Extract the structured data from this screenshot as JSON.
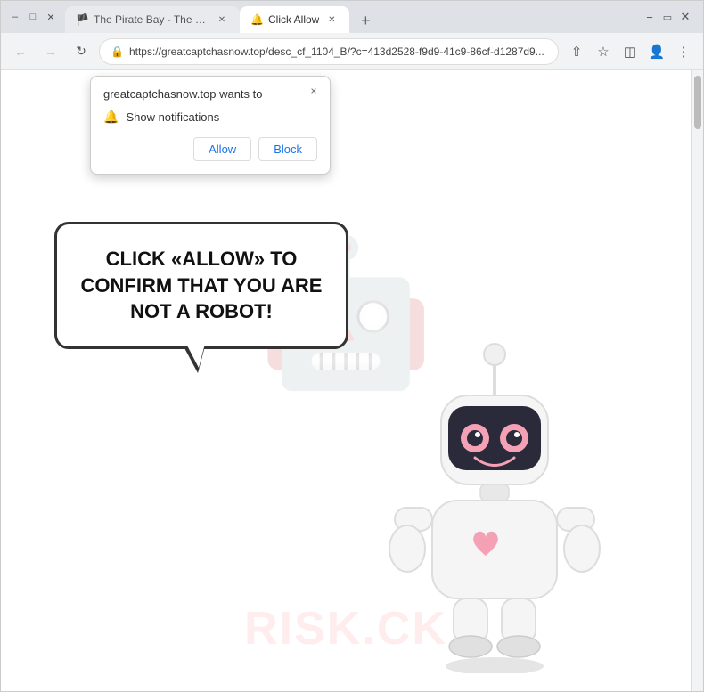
{
  "browser": {
    "tabs": [
      {
        "id": "tab1",
        "title": "The Pirate Bay - The galaxy's mo...",
        "favicon": "🏴",
        "active": false
      },
      {
        "id": "tab2",
        "title": "Click Allow",
        "favicon": "🔔",
        "active": true
      }
    ],
    "new_tab_label": "+",
    "url": "https://greatcaptchasnow.top/desc_cf_1104_B/?c=413d2528-f9d9-41c9-86cf-d1287d9...",
    "nav": {
      "back": "←",
      "forward": "→",
      "refresh": "↻"
    },
    "toolbar": {
      "share": "⬆",
      "bookmark": "☆",
      "extension": "▣",
      "account": "👤",
      "menu": "⋮"
    }
  },
  "popup": {
    "site": "greatcaptchasnow.top wants to",
    "permission": "Show notifications",
    "allow_label": "Allow",
    "block_label": "Block",
    "close_label": "×"
  },
  "page": {
    "bubble_text": "CLICK «ALLOW» TO CONFIRM THAT YOU ARE NOT A ROBOT!",
    "watermark": "RISK.CK"
  },
  "colors": {
    "allow_text": "#1a73e8",
    "block_text": "#1a73e8",
    "bubble_border": "#333",
    "robot_body": "#fff",
    "robot_accent": "#f4a0b5"
  }
}
